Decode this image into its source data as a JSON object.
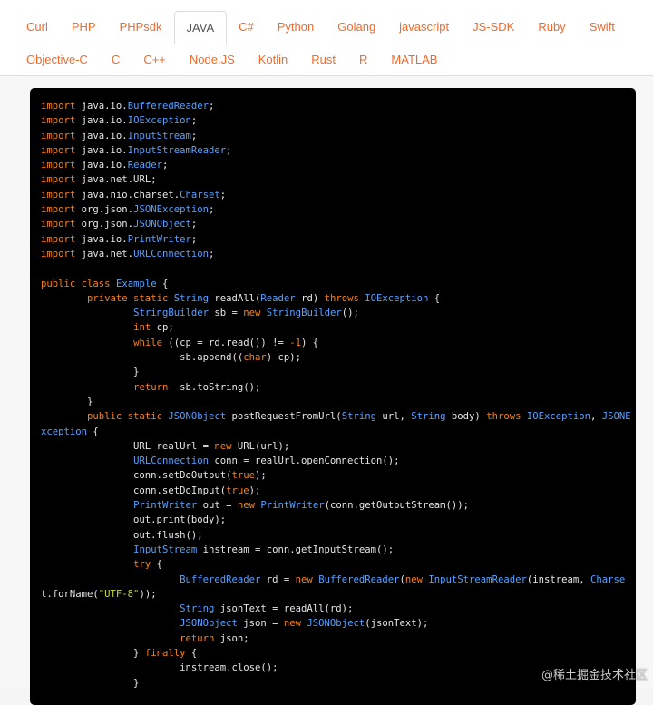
{
  "tabs": {
    "row1": [
      "Curl",
      "PHP",
      "PHPsdk",
      "JAVA",
      "C#",
      "Python",
      "Golang",
      "javascript",
      "JS-SDK",
      "Ruby",
      "Swift"
    ],
    "row2": [
      "Objective-C",
      "C",
      "C++",
      "Node.JS",
      "Kotlin",
      "Rust",
      "R",
      "MATLAB"
    ],
    "active": "JAVA"
  },
  "colors": {
    "tab_text": "#f06a2a",
    "active_tab_text": "#555555",
    "code_bg": "#000000",
    "keyword": "#f4801f",
    "type": "#57a0ff",
    "string": "#c8d840",
    "plain": "#e6e6e6"
  },
  "code": {
    "language": "java",
    "lines": [
      [
        [
          "k",
          "import"
        ],
        [
          "n",
          " java.io."
        ],
        [
          "t",
          "BufferedReader"
        ],
        [
          "n",
          ";"
        ]
      ],
      [
        [
          "k",
          "import"
        ],
        [
          "n",
          " java.io."
        ],
        [
          "t",
          "IOException"
        ],
        [
          "n",
          ";"
        ]
      ],
      [
        [
          "k",
          "import"
        ],
        [
          "n",
          " java.io."
        ],
        [
          "t",
          "InputStream"
        ],
        [
          "n",
          ";"
        ]
      ],
      [
        [
          "k",
          "import"
        ],
        [
          "n",
          " java.io."
        ],
        [
          "t",
          "InputStreamReader"
        ],
        [
          "n",
          ";"
        ]
      ],
      [
        [
          "k",
          "import"
        ],
        [
          "n",
          " java.io."
        ],
        [
          "t",
          "Reader"
        ],
        [
          "n",
          ";"
        ]
      ],
      [
        [
          "k",
          "import"
        ],
        [
          "n",
          " java.net.URL;"
        ]
      ],
      [
        [
          "k",
          "import"
        ],
        [
          "n",
          " java.nio.charset."
        ],
        [
          "t",
          "Charset"
        ],
        [
          "n",
          ";"
        ]
      ],
      [
        [
          "k",
          "import"
        ],
        [
          "n",
          " org.json."
        ],
        [
          "t",
          "JSONException"
        ],
        [
          "n",
          ";"
        ]
      ],
      [
        [
          "k",
          "import"
        ],
        [
          "n",
          " org.json."
        ],
        [
          "t",
          "JSONObject"
        ],
        [
          "n",
          ";"
        ]
      ],
      [
        [
          "k",
          "import"
        ],
        [
          "n",
          " java.io."
        ],
        [
          "t",
          "PrintWriter"
        ],
        [
          "n",
          ";"
        ]
      ],
      [
        [
          "k",
          "import"
        ],
        [
          "n",
          " java.net."
        ],
        [
          "t",
          "URLConnection"
        ],
        [
          "n",
          ";"
        ]
      ],
      [],
      [
        [
          "k",
          "public class"
        ],
        [
          "n",
          " "
        ],
        [
          "t",
          "Example"
        ],
        [
          "n",
          " {"
        ]
      ],
      [
        [
          "n",
          "        "
        ],
        [
          "k",
          "private static"
        ],
        [
          "n",
          " "
        ],
        [
          "t",
          "String"
        ],
        [
          "n",
          " readAll("
        ],
        [
          "t",
          "Reader"
        ],
        [
          "n",
          " rd) "
        ],
        [
          "k",
          "throws"
        ],
        [
          "n",
          " "
        ],
        [
          "t",
          "IOException"
        ],
        [
          "n",
          " {"
        ]
      ],
      [
        [
          "n",
          "                "
        ],
        [
          "t",
          "StringBuilder"
        ],
        [
          "n",
          " sb = "
        ],
        [
          "k",
          "new"
        ],
        [
          "n",
          " "
        ],
        [
          "t",
          "StringBuilder"
        ],
        [
          "n",
          "();"
        ]
      ],
      [
        [
          "n",
          "                "
        ],
        [
          "k",
          "int"
        ],
        [
          "n",
          " cp;"
        ]
      ],
      [
        [
          "n",
          "                "
        ],
        [
          "k",
          "while"
        ],
        [
          "n",
          " ((cp = rd.read()) != "
        ],
        [
          "k",
          "-1"
        ],
        [
          "n",
          ") {"
        ]
      ],
      [
        [
          "n",
          "                        sb.append(("
        ],
        [
          "k",
          "char"
        ],
        [
          "n",
          ") cp);"
        ]
      ],
      [
        [
          "n",
          "                }"
        ]
      ],
      [
        [
          "n",
          "                "
        ],
        [
          "k",
          "return"
        ],
        [
          "n",
          "  sb.toString();"
        ]
      ],
      [
        [
          "n",
          "        }"
        ]
      ],
      [
        [
          "n",
          "        "
        ],
        [
          "k",
          "public static"
        ],
        [
          "n",
          " "
        ],
        [
          "t",
          "JSONObject"
        ],
        [
          "n",
          " postRequestFromUrl("
        ],
        [
          "t",
          "String"
        ],
        [
          "n",
          " url, "
        ],
        [
          "t",
          "String"
        ],
        [
          "n",
          " body) "
        ],
        [
          "k",
          "throws"
        ],
        [
          "n",
          " "
        ],
        [
          "t",
          "IOException"
        ],
        [
          "n",
          ", "
        ],
        [
          "t",
          "JSONE"
        ]
      ],
      [
        [
          "t",
          "xception"
        ],
        [
          "n",
          " {"
        ]
      ],
      [
        [
          "n",
          "                URL realUrl = "
        ],
        [
          "k",
          "new"
        ],
        [
          "n",
          " URL(url);"
        ]
      ],
      [
        [
          "n",
          "                "
        ],
        [
          "t",
          "URLConnection"
        ],
        [
          "n",
          " conn = realUrl.openConnection();"
        ]
      ],
      [
        [
          "n",
          "                conn.setDoOutput("
        ],
        [
          "k",
          "true"
        ],
        [
          "n",
          ");"
        ]
      ],
      [
        [
          "n",
          "                conn.setDoInput("
        ],
        [
          "k",
          "true"
        ],
        [
          "n",
          ");"
        ]
      ],
      [
        [
          "n",
          "                "
        ],
        [
          "t",
          "PrintWriter"
        ],
        [
          "n",
          " out = "
        ],
        [
          "k",
          "new"
        ],
        [
          "n",
          " "
        ],
        [
          "t",
          "PrintWriter"
        ],
        [
          "n",
          "(conn.getOutputStream());"
        ]
      ],
      [
        [
          "n",
          "                out.print(body);"
        ]
      ],
      [
        [
          "n",
          "                out.flush();"
        ]
      ],
      [
        [
          "n",
          "                "
        ],
        [
          "t",
          "InputStream"
        ],
        [
          "n",
          " instream = conn.getInputStream();"
        ]
      ],
      [
        [
          "n",
          "                "
        ],
        [
          "k",
          "try"
        ],
        [
          "n",
          " {"
        ]
      ],
      [
        [
          "n",
          "                        "
        ],
        [
          "t",
          "BufferedReader"
        ],
        [
          "n",
          " rd = "
        ],
        [
          "k",
          "new"
        ],
        [
          "n",
          " "
        ],
        [
          "t",
          "BufferedReader"
        ],
        [
          "n",
          "("
        ],
        [
          "k",
          "new"
        ],
        [
          "n",
          " "
        ],
        [
          "t",
          "InputStreamReader"
        ],
        [
          "n",
          "(instream, "
        ],
        [
          "t",
          "Charse"
        ]
      ],
      [
        [
          "n",
          "t.forName("
        ],
        [
          "s",
          "\"UTF-8\""
        ],
        [
          "n",
          "));"
        ]
      ],
      [
        [
          "n",
          "                        "
        ],
        [
          "t",
          "String"
        ],
        [
          "n",
          " jsonText = readAll(rd);"
        ]
      ],
      [
        [
          "n",
          "                        "
        ],
        [
          "t",
          "JSONObject"
        ],
        [
          "n",
          " json = "
        ],
        [
          "k",
          "new"
        ],
        [
          "n",
          " "
        ],
        [
          "t",
          "JSONObject"
        ],
        [
          "n",
          "(jsonText);"
        ]
      ],
      [
        [
          "n",
          "                        "
        ],
        [
          "k",
          "return"
        ],
        [
          "n",
          " json;"
        ]
      ],
      [
        [
          "n",
          "                } "
        ],
        [
          "k",
          "finally"
        ],
        [
          "n",
          " {"
        ]
      ],
      [
        [
          "n",
          "                        instream.close();"
        ]
      ],
      [
        [
          "n",
          "                }"
        ]
      ]
    ]
  },
  "watermark": "@稀土掘金技术社区"
}
